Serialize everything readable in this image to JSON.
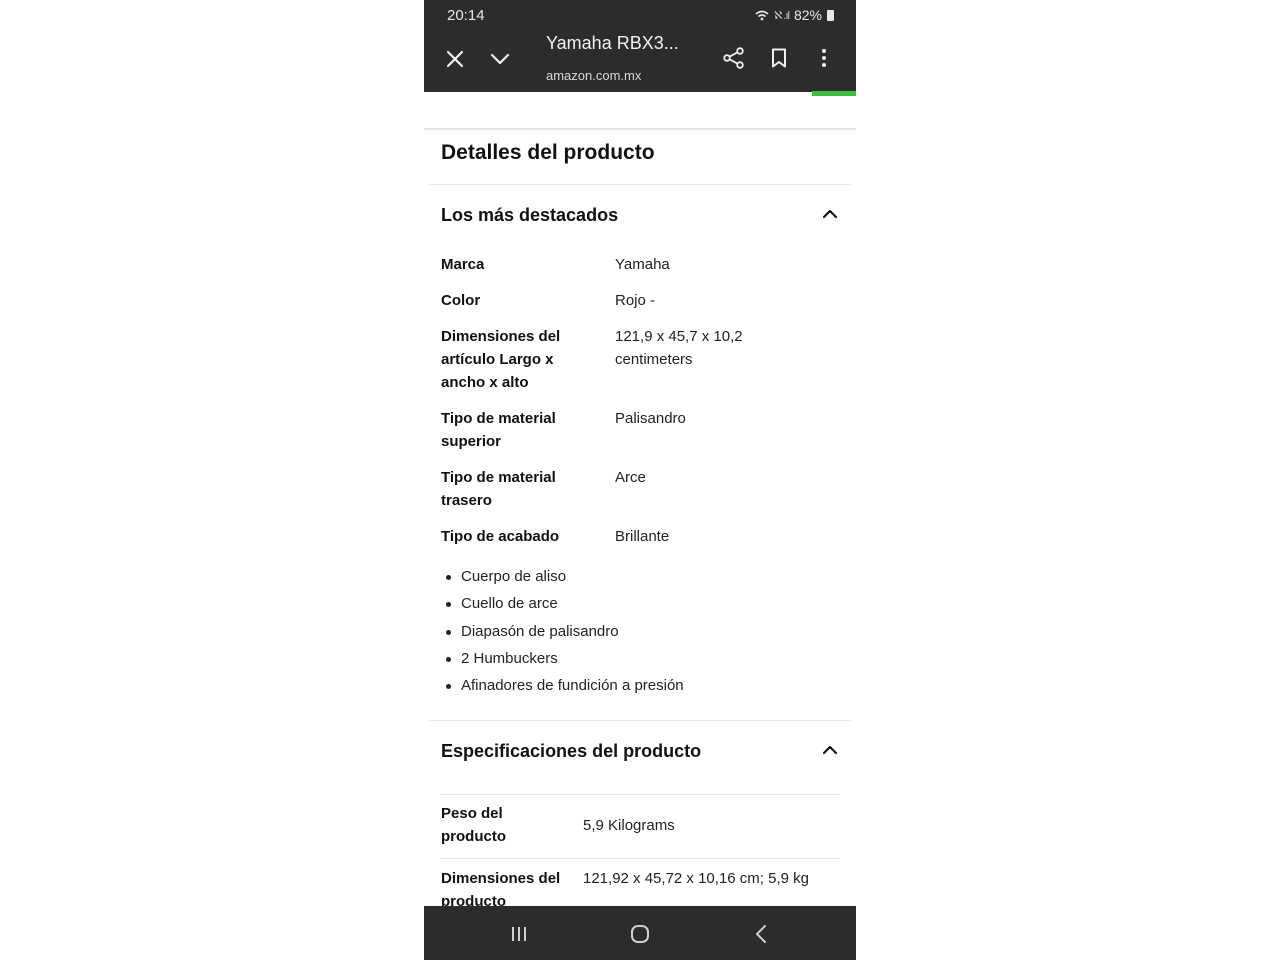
{
  "status_bar": {
    "time": "20:14",
    "signal_text": "ℵ .ıl",
    "battery": "82%"
  },
  "browser": {
    "title": "Yamaha RBX3...",
    "url": "amazon.com.mx",
    "icons": [
      "close-icon",
      "chevron-down-icon",
      "share-icon",
      "bookmark-icon",
      "more-vert-icon"
    ]
  },
  "page": {
    "heading": "Detalles del producto",
    "highlights": {
      "heading": "Los más destacados",
      "rows": [
        {
          "label": "Marca",
          "value": "Yamaha"
        },
        {
          "label": "Color",
          "value": "Rojo -"
        },
        {
          "label": "Dimensiones del artículo Largo x ancho x alto",
          "value": "121,9 x 45,7 x 10,2 centimeters"
        },
        {
          "label": "Tipo de material superior",
          "value": "Palisandro"
        },
        {
          "label": "Tipo de material trasero",
          "value": "Arce"
        },
        {
          "label": "Tipo de acabado",
          "value": "Brillante"
        }
      ],
      "bullets": [
        "Cuerpo de aliso",
        "Cuello de arce",
        "Diapasón de palisandro",
        "2 Humbuckers",
        "Afinadores de fundición a presión"
      ]
    },
    "specs": {
      "heading": "Especificaciones del producto",
      "rows": [
        {
          "label": "Peso del producto",
          "value": "5,9 Kilograms"
        },
        {
          "label": "Dimensiones del producto",
          "value": "121,92 x 45,72 x 10,16 cm; 5,9 kg"
        }
      ]
    }
  },
  "nav_bar": {
    "icons": [
      "recent-apps-icon",
      "home-icon",
      "back-icon"
    ]
  }
}
